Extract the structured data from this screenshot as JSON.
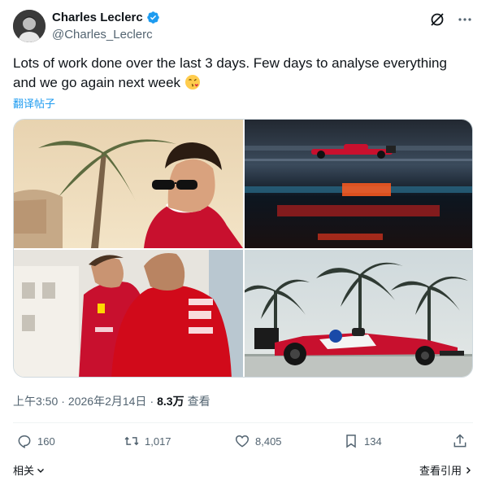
{
  "author": {
    "name": "Charles Leclerc",
    "handle": "@Charles_Leclerc"
  },
  "tweet": {
    "text": "Lots of work done over the last 3 days. Few days to analyse everything and we go again next week",
    "emoji": "face-blowing-kiss-emoji",
    "translate_label": "翻译帖子"
  },
  "meta": {
    "time": "上午3:50",
    "separator1": "·",
    "date": "2026年2月14日",
    "separator2": "·",
    "views_count": "8.3万",
    "views_label": "查看"
  },
  "actions": {
    "reply": "160",
    "retweet": "1,017",
    "like": "8,405",
    "bookmark": "134"
  },
  "footer": {
    "related": "相关",
    "quotes": "查看引用"
  },
  "colors": {
    "accent": "#1d9bf0",
    "text": "#0f1419",
    "muted": "#536471",
    "ferrari_red": "#d40000"
  }
}
